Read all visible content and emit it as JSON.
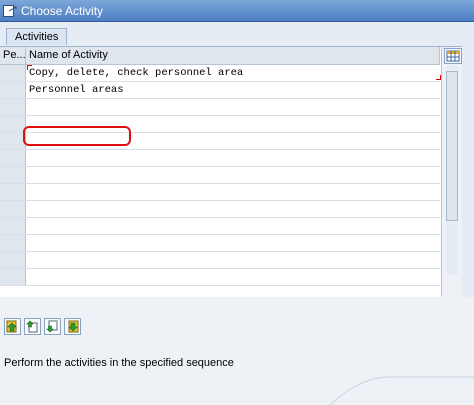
{
  "window": {
    "title": "Choose Activity"
  },
  "tab": {
    "label": "Activities"
  },
  "table": {
    "columns": [
      "Pe...",
      "Name of Activity"
    ],
    "rows": [
      {
        "name": "Copy, delete, check personnel area"
      },
      {
        "name": "Personnel areas"
      },
      {
        "name": ""
      },
      {
        "name": ""
      },
      {
        "name": ""
      },
      {
        "name": ""
      },
      {
        "name": ""
      },
      {
        "name": ""
      },
      {
        "name": ""
      },
      {
        "name": ""
      },
      {
        "name": ""
      },
      {
        "name": ""
      },
      {
        "name": ""
      }
    ]
  },
  "toolbar": {
    "buttons": [
      "up-activity-icon",
      "move-up-icon",
      "move-down-icon",
      "down-activity-icon"
    ]
  },
  "status": {
    "text": "Perform the activities in the specified sequence"
  },
  "colors": {
    "titlebar": "#4d7fc4",
    "highlight": "#d11111",
    "icon_green": "#2f9a2f",
    "icon_yellow": "#e8c531"
  }
}
